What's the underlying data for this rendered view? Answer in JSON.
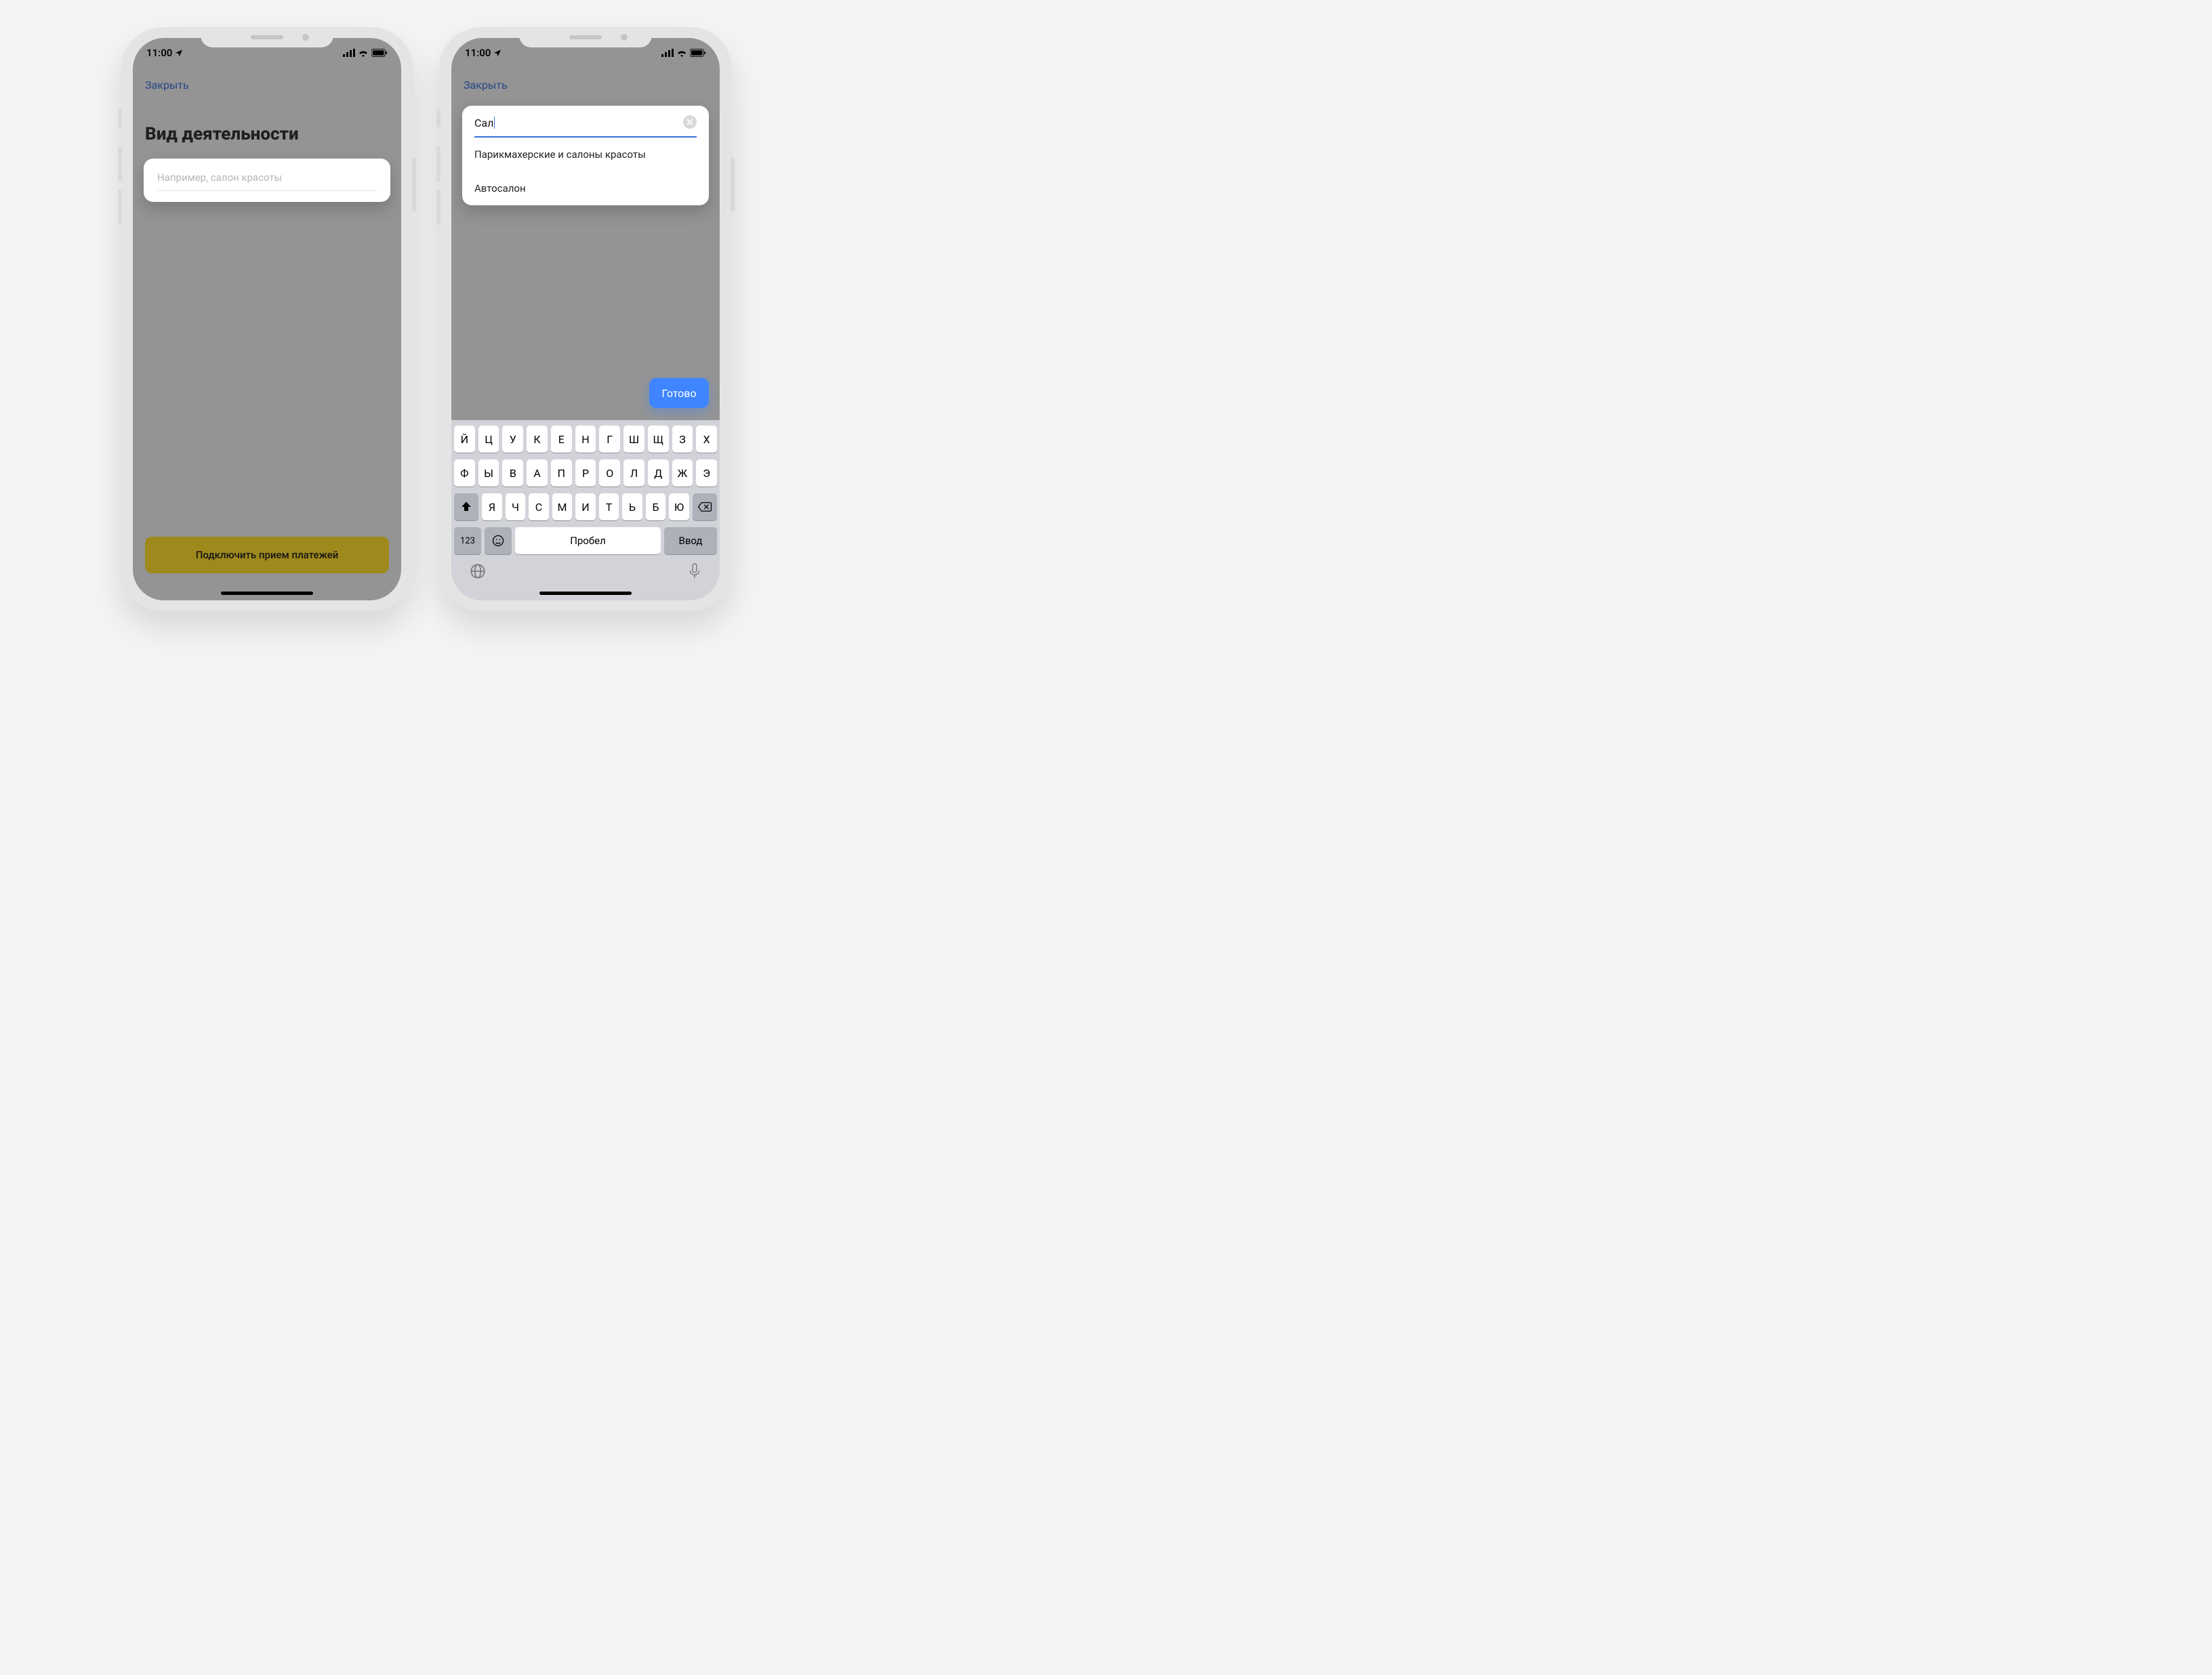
{
  "status": {
    "time": "11:00"
  },
  "left_screen": {
    "close_label": "Закрыть",
    "title": "Вид деятельности",
    "search_placeholder": "Например, салон красоты",
    "cta_label": "Подключить прием платежей"
  },
  "right_screen": {
    "close_label": "Закрыть",
    "search_value": "Сал",
    "suggestions": [
      "Парикмахерские и салоны красоты",
      "Автосалон"
    ],
    "done_label": "Готово"
  },
  "keyboard": {
    "row1": [
      "Й",
      "Ц",
      "У",
      "К",
      "Е",
      "Н",
      "Г",
      "Ш",
      "Щ",
      "З",
      "Х"
    ],
    "row2": [
      "Ф",
      "Ы",
      "В",
      "А",
      "П",
      "Р",
      "О",
      "Л",
      "Д",
      "Ж",
      "Э"
    ],
    "row3": [
      "Я",
      "Ч",
      "С",
      "М",
      "И",
      "Т",
      "Ь",
      "Б",
      "Ю"
    ],
    "abc": "123",
    "space": "Пробел",
    "enter": "Ввод"
  }
}
